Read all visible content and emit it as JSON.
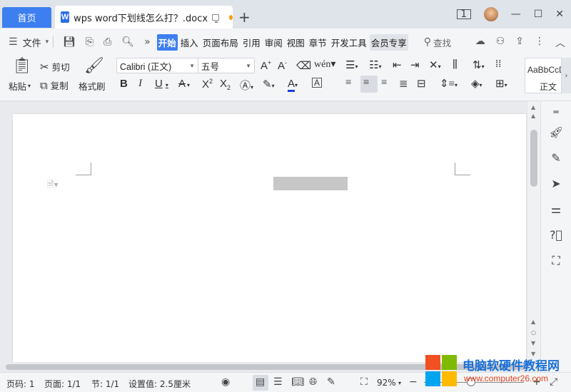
{
  "titlebar": {
    "home_tab": "首页",
    "doc_icon": "W",
    "doc_title": "wps word下划线怎么打？.docx",
    "new_tab": "+",
    "badge": "1"
  },
  "menubar": {
    "file_label": "文件",
    "tabs": [
      {
        "label": "开始",
        "active": true
      },
      {
        "label": "插入"
      },
      {
        "label": "页面布局"
      },
      {
        "label": "引用"
      },
      {
        "label": "审阅"
      },
      {
        "label": "视图"
      },
      {
        "label": "章节"
      },
      {
        "label": "开发工具"
      },
      {
        "label": "会员专享"
      }
    ],
    "search_label": "查找"
  },
  "toolbar": {
    "paste": "粘贴",
    "cut": "剪切",
    "copy": "复制",
    "format_painter": "格式刷",
    "font_name": "Calibri (正文)",
    "font_size": "五号",
    "style_preview": "AaBbCcDd",
    "style_name": "正文"
  },
  "statusbar": {
    "page_code": "页码: 1",
    "page": "页面: 1/1",
    "section": "节: 1/1",
    "setting": "设置值: 2.5厘米",
    "zoom": "92%"
  },
  "watermark": {
    "site_name": "电脑软硬件教程网",
    "site_url": "www.computer26.com"
  },
  "colors": {
    "accent": "#3d7ff0",
    "font_color_underline": "#1a3fe0"
  }
}
